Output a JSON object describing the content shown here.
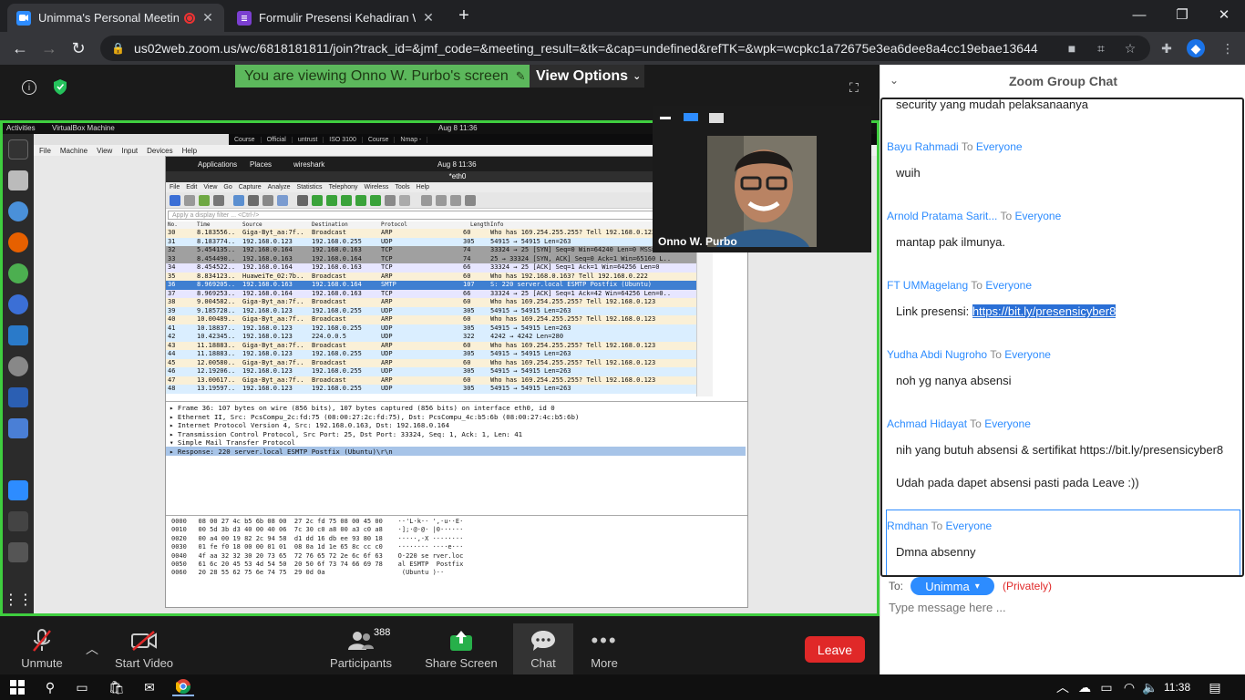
{
  "browser": {
    "tabs": [
      {
        "title": "Unimma's Personal Meeting",
        "active": true
      },
      {
        "title": "Formulir Presensi Kehadiran Web",
        "active": false
      }
    ],
    "url": "us02web.zoom.us/wc/6818181811/join?track_id=&jmf_code=&meeting_result=&tk=&cap=undefined&refTK=&wpk=wcpkc1a72675e3ea6dee8a4cc19ebae13644"
  },
  "meeting": {
    "banner": "You are viewing Onno W. Purbo's screen",
    "view_options": "View Options",
    "presenter_name": "Onno W. Purbo"
  },
  "screen": {
    "ubuntu_activities": "Activities",
    "ubuntu_app": "VirtualBox Machine",
    "ubuntu_clock": "Aug 8  11:36",
    "vbox_menu": [
      "File",
      "Machine",
      "View",
      "Input",
      "Devices",
      "Help"
    ],
    "ff_tabs": [
      "Course",
      "Official",
      "untrust",
      "ISO 3100",
      "Course",
      "Nmap -"
    ],
    "guest_menu": [
      "Applications",
      "Places",
      "wireshark"
    ],
    "guest_clock": "Aug 8  11:36",
    "ws_title": "*eth0",
    "ws_menu": [
      "File",
      "Edit",
      "View",
      "Go",
      "Capture",
      "Analyze",
      "Statistics",
      "Telephony",
      "Wireless",
      "Tools",
      "Help"
    ],
    "ws_filter": "Apply a display filter ... <Ctrl-/>",
    "columns": [
      "No.",
      "Time",
      "Source",
      "Destination",
      "Protocol",
      "Length",
      "Info"
    ],
    "packets": [
      [
        "30",
        "8.183556..",
        "Giga-Byt_aa:7f..",
        "Broadcast",
        "ARP",
        "60",
        "Who has 169.254.255.255? Tell 192.168.0.123"
      ],
      [
        "31",
        "8.183774..",
        "192.168.0.123",
        "192.168.0.255",
        "UDP",
        "305",
        "54915 → 54915 Len=263"
      ],
      [
        "32",
        "5.454135..",
        "192.168.0.164",
        "192.168.0.163",
        "TCP",
        "74",
        "33324 → 25 [SYN] Seq=0 Win=64240 Len=0 MSS=14.."
      ],
      [
        "33",
        "8.454490..",
        "192.168.0.163",
        "192.168.0.164",
        "TCP",
        "74",
        "25 → 33324 [SYN, ACK] Seq=0 Ack=1 Win=65160 L.."
      ],
      [
        "34",
        "8.454522..",
        "192.168.0.164",
        "192.168.0.163",
        "TCP",
        "66",
        "33324 → 25 [ACK] Seq=1 Ack=1 Win=64256 Len=0"
      ],
      [
        "35",
        "8.834123..",
        "HuaweiTe_02:7b..",
        "Broadcast",
        "ARP",
        "60",
        "Who has 192.168.0.163? Tell 192.168.0.222"
      ],
      [
        "36",
        "8.969205..",
        "192.168.0.163",
        "192.168.0.164",
        "SMTP",
        "107",
        "S: 220 server.local ESMTP Postfix (Ubuntu)"
      ],
      [
        "37",
        "8.969253..",
        "192.168.0.164",
        "192.168.0.163",
        "TCP",
        "66",
        "33324 → 25 [ACK] Seq=1 Ack=42 Win=64256 Len=0.."
      ],
      [
        "38",
        "9.004582..",
        "Giga-Byt_aa:7f..",
        "Broadcast",
        "ARP",
        "60",
        "Who has 169.254.255.255? Tell 192.168.0.123"
      ],
      [
        "39",
        "9.185728..",
        "192.168.0.123",
        "192.168.0.255",
        "UDP",
        "305",
        "54915 → 54915 Len=263"
      ],
      [
        "40",
        "10.00489..",
        "Giga-Byt_aa:7f..",
        "Broadcast",
        "ARP",
        "60",
        "Who has 169.254.255.255? Tell 192.168.0.123"
      ],
      [
        "41",
        "10.18837..",
        "192.168.0.123",
        "192.168.0.255",
        "UDP",
        "305",
        "54915 → 54915 Len=263"
      ],
      [
        "42",
        "10.42345..",
        "192.168.0.123",
        "224.0.0.5",
        "UDP",
        "322",
        "4242 → 4242 Len=280"
      ],
      [
        "43",
        "11.18883..",
        "Giga-Byt_aa:7f..",
        "Broadcast",
        "ARP",
        "60",
        "Who has 169.254.255.255? Tell 192.168.0.123"
      ],
      [
        "44",
        "11.18883..",
        "192.168.0.123",
        "192.168.0.255",
        "UDP",
        "305",
        "54915 → 54915 Len=263"
      ],
      [
        "45",
        "12.00580..",
        "Giga-Byt_aa:7f..",
        "Broadcast",
        "ARP",
        "60",
        "Who has 169.254.255.255? Tell 192.168.0.123"
      ],
      [
        "46",
        "12.19206..",
        "192.168.0.123",
        "192.168.0.255",
        "UDP",
        "305",
        "54915 → 54915 Len=263"
      ],
      [
        "47",
        "13.00617..",
        "Giga-Byt_aa:7f..",
        "Broadcast",
        "ARP",
        "60",
        "Who has 169.254.255.255? Tell 192.168.0.123"
      ],
      [
        "48",
        "13.19597..",
        "192.168.0.123",
        "192.168.0.255",
        "UDP",
        "305",
        "54915 → 54915 Len=263"
      ]
    ],
    "details": [
      "▸ Frame 36: 107 bytes on wire (856 bits), 107 bytes captured (856 bits) on interface eth0, id 0",
      "▸ Ethernet II, Src: PcsCompu_2c:fd:75 (08:00:27:2c:fd:75), Dst: PcsCompu_4c:b5:6b (08:00:27:4c:b5:6b)",
      "▸ Internet Protocol Version 4, Src: 192.168.0.163, Dst: 192.168.0.164",
      "▸ Transmission Control Protocol, Src Port: 25, Dst Port: 33324, Seq: 1, Ack: 1, Len: 41",
      "▾ Simple Mail Transfer Protocol",
      "   ▸ Response: 220 server.local ESMTP Postfix (Ubuntu)\\r\\n"
    ],
    "hex": [
      "0000   08 00 27 4c b5 6b 08 00  27 2c fd 75 08 00 45 00    ··'L·k·· ',·u··E·",
      "0010   00 5d 3b d3 40 00 40 06  7c 30 c0 a8 00 a3 c0 a8    ·];·@·@· |0······",
      "0020   00 a4 00 19 82 2c 94 58  d1 dd 16 db ee 93 80 18    ·····,·X ········",
      "0030   01 fe f0 18 00 00 01 01  08 0a 1d 1e 65 8c cc c0    ········ ····e···",
      "0040   4f aa 32 32 30 20 73 65  72 76 65 72 2e 6c 6f 63    O·220 se rver.loc",
      "0050   61 6c 20 45 53 4d 54 50  20 50 6f 73 74 66 69 78    al ESMTP  Postfix",
      "0060   20 28 55 62 75 6e 74 75  29 0d 0a                    (Ubuntu )··"
    ]
  },
  "toolbar": {
    "unmute": "Unmute",
    "start_video": "Start Video",
    "participants": "Participants",
    "participants_count": "388",
    "share_screen": "Share Screen",
    "chat": "Chat",
    "more": "More",
    "leave": "Leave"
  },
  "chat": {
    "title": "Zoom Group Chat",
    "to_word": "To",
    "messages": [
      {
        "sender": "",
        "to": "",
        "text": "security yang mudah pelaksanaanya"
      },
      {
        "sender": "Bayu Rahmadi",
        "to": "Everyone",
        "text": "wuih"
      },
      {
        "sender": "Arnold Pratama Sarit...",
        "to": "Everyone",
        "text": "mantap pak ilmunya."
      },
      {
        "sender": "FT UMMagelang",
        "to": "Everyone",
        "text": "Link presensi: ",
        "link": "https://bit.ly/presensicyber8"
      },
      {
        "sender": "Yudha Abdi Nugroho",
        "to": "Everyone",
        "text": "noh yg nanya absensi"
      },
      {
        "sender": "Achmad Hidayat",
        "to": "Everyone",
        "text": "nih yang butuh absensi & sertifikat https://bit.ly/presensicyber8",
        "text2": "Udah pada dapet absensi pasti pada Leave :))"
      },
      {
        "sender": "Rmdhan",
        "to": "Everyone",
        "text": "Dmna absenny"
      }
    ],
    "to_label": "To:",
    "recipient": "Unimma",
    "privately": "(Privately)",
    "input_placeholder": "Type message here ..."
  },
  "taskbar": {
    "time": "11:38"
  }
}
